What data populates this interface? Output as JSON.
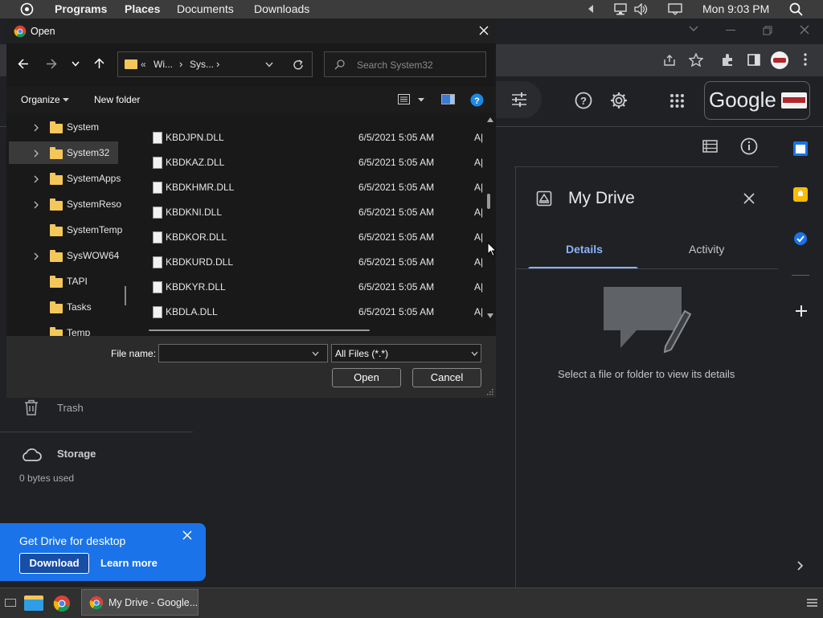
{
  "desktop_bar": {
    "programs": "Programs",
    "places": "Places",
    "documents": "Documents",
    "downloads": "Downloads",
    "clock": "Mon 9:03 PM"
  },
  "drive": {
    "google_logo": "Google",
    "details": {
      "title": "My Drive",
      "tab_details": "Details",
      "tab_activity": "Activity",
      "empty_message": "Select a file or folder to view its details"
    },
    "sidebar": {
      "trash": "Trash",
      "storage": "Storage",
      "storage_used": "0 bytes used"
    },
    "promo": {
      "title": "Get Drive for desktop",
      "download": "Download",
      "learn_more": "Learn more"
    }
  },
  "dialog": {
    "title": "Open",
    "breadcrumb": [
      "«",
      "Wi...",
      "›",
      "Sys...",
      "›"
    ],
    "search_placeholder": "Search System32",
    "organize": "Organize",
    "new_folder": "New folder",
    "tree": [
      {
        "label": "System",
        "expandable": true
      },
      {
        "label": "System32",
        "expandable": true,
        "selected": true
      },
      {
        "label": "SystemApps",
        "expandable": true
      },
      {
        "label": "SystemReso",
        "expandable": true
      },
      {
        "label": "SystemTemp",
        "expandable": false
      },
      {
        "label": "SysWOW64",
        "expandable": true
      },
      {
        "label": "TAPI",
        "expandable": false
      },
      {
        "label": "Tasks",
        "expandable": false
      },
      {
        "label": "Temp",
        "expandable": false
      }
    ],
    "files": [
      {
        "name": "KBDJPN.DLL",
        "date": "6/5/2021 5:05 AM",
        "type": "A|"
      },
      {
        "name": "KBDKAZ.DLL",
        "date": "6/5/2021 5:05 AM",
        "type": "A|"
      },
      {
        "name": "KBDKHMR.DLL",
        "date": "6/5/2021 5:05 AM",
        "type": "A|"
      },
      {
        "name": "KBDKNI.DLL",
        "date": "6/5/2021 5:05 AM",
        "type": "A|"
      },
      {
        "name": "KBDKOR.DLL",
        "date": "6/5/2021 5:05 AM",
        "type": "A|"
      },
      {
        "name": "KBDKURD.DLL",
        "date": "6/5/2021 5:05 AM",
        "type": "A|"
      },
      {
        "name": "KBDKYR.DLL",
        "date": "6/5/2021 5:05 AM",
        "type": "A|"
      },
      {
        "name": "KBDLA.DLL",
        "date": "6/5/2021 5:05 AM",
        "type": "A|"
      }
    ],
    "file_name_label": "File name:",
    "file_name_value": "",
    "filter": "All Files (*.*)",
    "open_button": "Open",
    "cancel_button": "Cancel"
  },
  "taskbar": {
    "active_window": "My Drive - Google..."
  }
}
